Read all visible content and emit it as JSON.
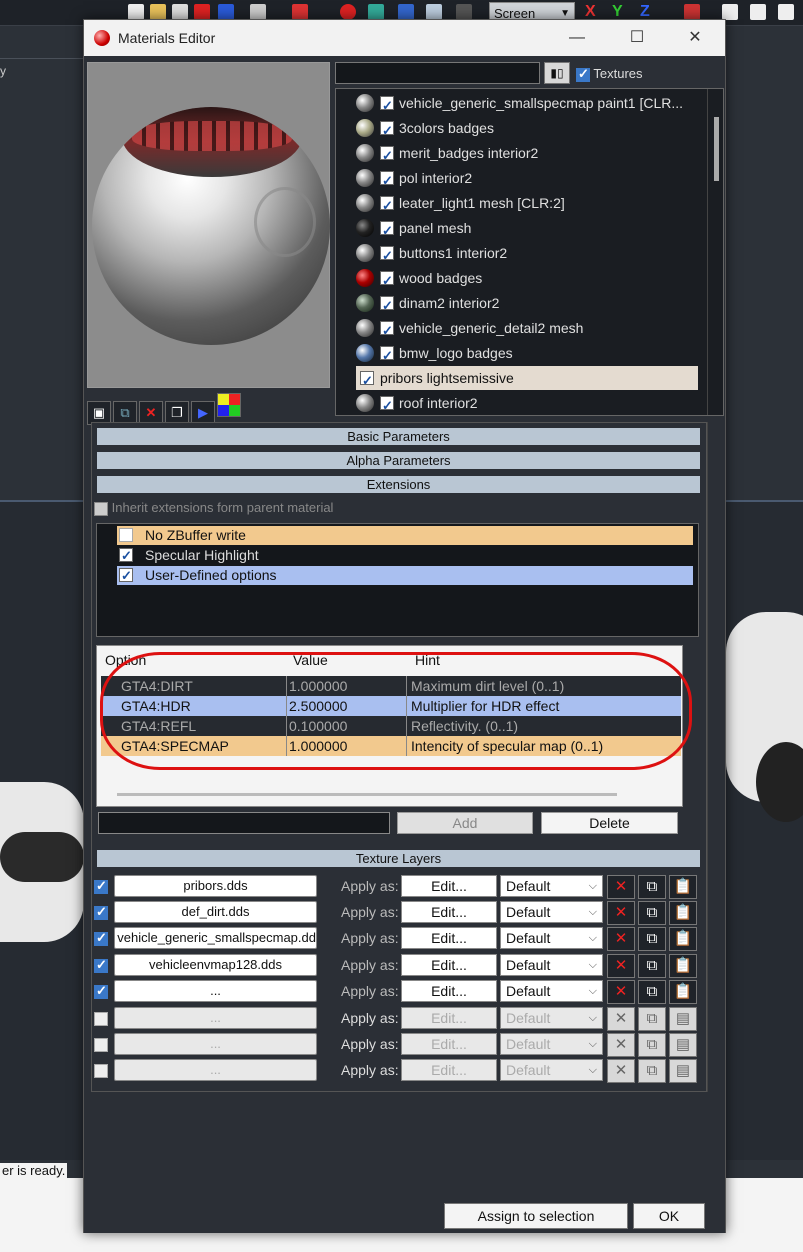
{
  "background": {
    "toolbar_select": "Screen",
    "axes": [
      "X",
      "Y",
      "Z"
    ],
    "left_menu_label": "y",
    "status_text": "er is ready."
  },
  "dialog": {
    "title": "Materials Editor",
    "title_buttons": {
      "minimize": "—",
      "maximize": "☐",
      "close": "✕"
    },
    "search": {
      "value": "",
      "placeholder": ""
    },
    "filter_button_label": "▮▯",
    "textures_label": "Textures",
    "textures_checked": true,
    "materials": [
      {
        "name": "vehicle_generic_smallspecmap paint1 [CLR...",
        "checked": true
      },
      {
        "name": "3colors badges",
        "checked": true
      },
      {
        "name": "merit_badges interior2",
        "checked": true
      },
      {
        "name": "pol interior2",
        "checked": true
      },
      {
        "name": "leater_light1 mesh [CLR:2]",
        "checked": true
      },
      {
        "name": "panel mesh",
        "checked": true
      },
      {
        "name": "buttons1 interior2",
        "checked": true
      },
      {
        "name": "wood badges",
        "checked": true
      },
      {
        "name": "dinam2 interior2",
        "checked": true
      },
      {
        "name": "vehicle_generic_detail2 mesh",
        "checked": true
      },
      {
        "name": "bmw_logo badges",
        "checked": true
      },
      {
        "name": "pribors lightsemissive",
        "checked": true,
        "selected": true
      },
      {
        "name": "roof interior2",
        "checked": true
      }
    ],
    "rollouts": {
      "basic": "Basic Parameters",
      "alpha": "Alpha Parameters",
      "extensions": "Extensions",
      "texture_layers": "Texture Layers"
    },
    "inherit_label": "Inherit extensions form parent material",
    "extensions": [
      {
        "label": "No ZBuffer write",
        "checked": false,
        "style": "orange"
      },
      {
        "label": "Specular Highlight",
        "checked": true,
        "style": "none"
      },
      {
        "label": "User-Defined options",
        "checked": true,
        "style": "blue"
      }
    ],
    "options_table": {
      "headers": {
        "option": "Option",
        "value": "Value",
        "hint": "Hint"
      },
      "rows": [
        {
          "option": "GTA4:DIRT",
          "value": "1.000000",
          "hint": "Maximum dirt level (0..1)",
          "style": "dark"
        },
        {
          "option": "GTA4:HDR",
          "value": "2.500000",
          "hint": "Multiplier for HDR effect",
          "style": "blue"
        },
        {
          "option": "GTA4:REFL",
          "value": "0.100000",
          "hint": "Reflectivity. (0..1)",
          "style": "dark"
        },
        {
          "option": "GTA4:SPECMAP",
          "value": "1.000000",
          "hint": "Intencity of specular map (0..1)",
          "style": "orange"
        }
      ]
    },
    "option_input": {
      "value": ""
    },
    "add_label": "Add",
    "delete_label": "Delete",
    "texture_layers": [
      {
        "file": "pribors.dds",
        "apply_label": "Apply as:",
        "edit_label": "Edit...",
        "mode": "Default",
        "checked": true,
        "enabled": true
      },
      {
        "file": "def_dirt.dds",
        "apply_label": "Apply as:",
        "edit_label": "Edit...",
        "mode": "Default",
        "checked": true,
        "enabled": true
      },
      {
        "file": "vehicle_generic_smallspecmap.dd",
        "apply_label": "Apply as:",
        "edit_label": "Edit...",
        "mode": "Default",
        "checked": true,
        "enabled": true
      },
      {
        "file": "vehicleenvmap128.dds",
        "apply_label": "Apply as:",
        "edit_label": "Edit...",
        "mode": "Default",
        "checked": true,
        "enabled": true
      },
      {
        "file": "...",
        "apply_label": "Apply as:",
        "edit_label": "Edit...",
        "mode": "Default",
        "checked": true,
        "enabled": true
      },
      {
        "file": "...",
        "apply_label": "Apply as:",
        "edit_label": "Edit...",
        "mode": "Default",
        "checked": false,
        "enabled": false
      },
      {
        "file": "...",
        "apply_label": "Apply as:",
        "edit_label": "Edit...",
        "mode": "Default",
        "checked": false,
        "enabled": false
      },
      {
        "file": "...",
        "apply_label": "Apply as:",
        "edit_label": "Edit...",
        "mode": "Default",
        "checked": false,
        "enabled": false
      }
    ],
    "assign_label": "Assign to selection",
    "ok_label": "OK"
  }
}
